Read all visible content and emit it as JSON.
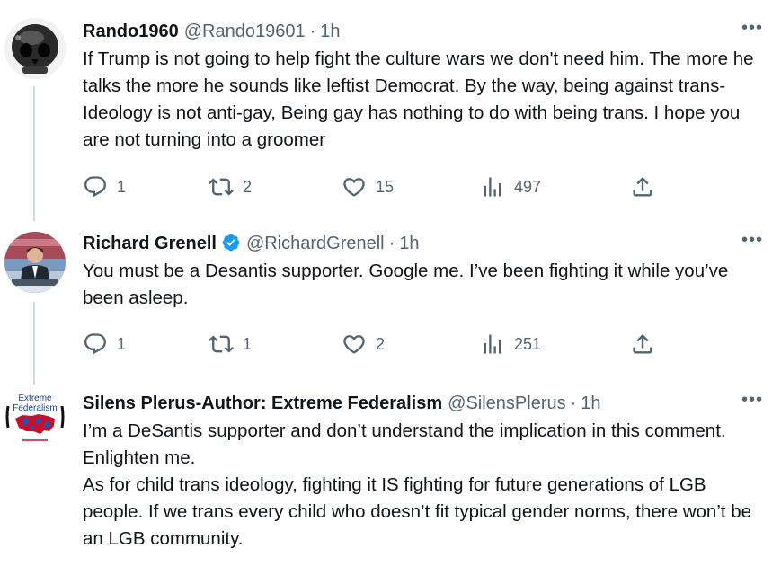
{
  "tweets": [
    {
      "name": "Rando1960",
      "handle": "@Rando19601",
      "time": "1h",
      "text": "If Trump is not going to help fight the culture wars we don't need him. The more he talks the more he sounds like leftist Democrat. By the way, being against trans-Ideology is not anti-gay, Being gay has nothing to do with being trans. I hope you are not turning into a groomer",
      "verified": false,
      "replies": "1",
      "retweets": "2",
      "likes": "15",
      "views": "497"
    },
    {
      "name": "Richard Grenell",
      "handle": "@RichardGrenell",
      "time": "1h",
      "text": "You must be a Desantis supporter. Google me. I’ve been fighting it while you’ve been asleep.",
      "verified": true,
      "replies": "1",
      "retweets": "1",
      "likes": "2",
      "views": "251"
    },
    {
      "name": "Silens Plerus-Author: Extreme Federalism",
      "handle": "@SilensPlerus",
      "time": "1h",
      "text": "I’m a DeSantis supporter and don’t understand the implication in this comment. Enlighten me.\nAs for child trans ideology, fighting it IS fighting for future generations of LGB people. If we trans every child who doesn’t fit typical gender norms, there won’t be an LGB community.",
      "verified": false,
      "avatar_text_1": "Extreme",
      "avatar_text_2": "Federalism"
    }
  ],
  "ui": {
    "separator": "·",
    "more": "•••"
  },
  "colors": {
    "text": "#0f1419",
    "secondary": "#536471",
    "verified": "#1d9bf0",
    "thread_line": "#cfd9de"
  }
}
